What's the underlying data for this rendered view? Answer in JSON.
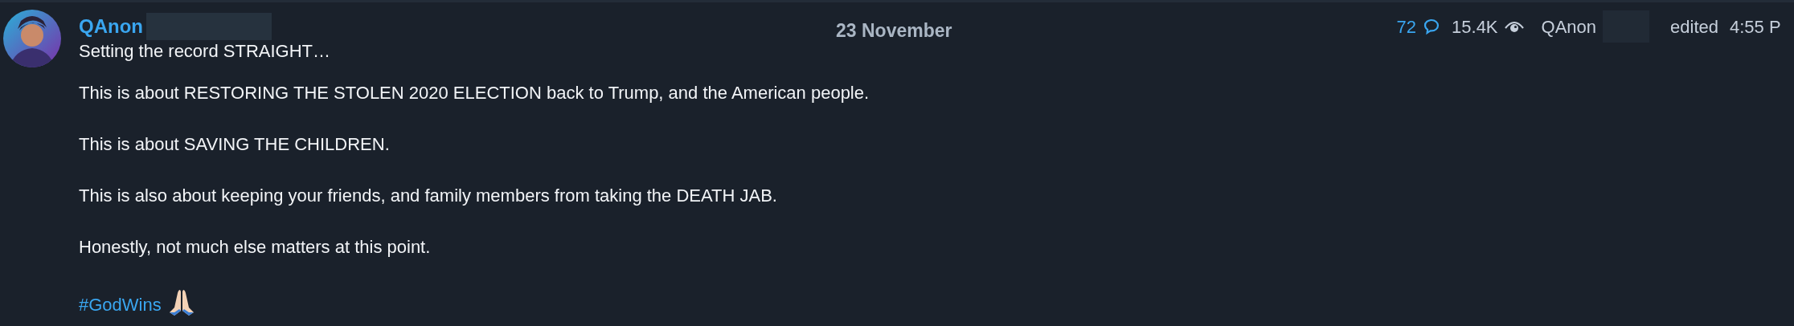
{
  "message": {
    "author": "QAnon",
    "date": "23 November",
    "meta": {
      "replies": "72",
      "views": "15.4K",
      "signature": "QAnon",
      "edited": "edited",
      "time": "4:55 P"
    },
    "paragraphs": [
      "Setting the record STRAIGHT…",
      "This is about RESTORING THE STOLEN 2020 ELECTION back to Trump, and the American people.",
      "This is about SAVING THE CHILDREN.",
      "This is also about keeping your friends, and family members from taking the DEATH JAB.",
      "Honestly, not much else matters at this point."
    ],
    "hashtag": "#GodWins"
  }
}
